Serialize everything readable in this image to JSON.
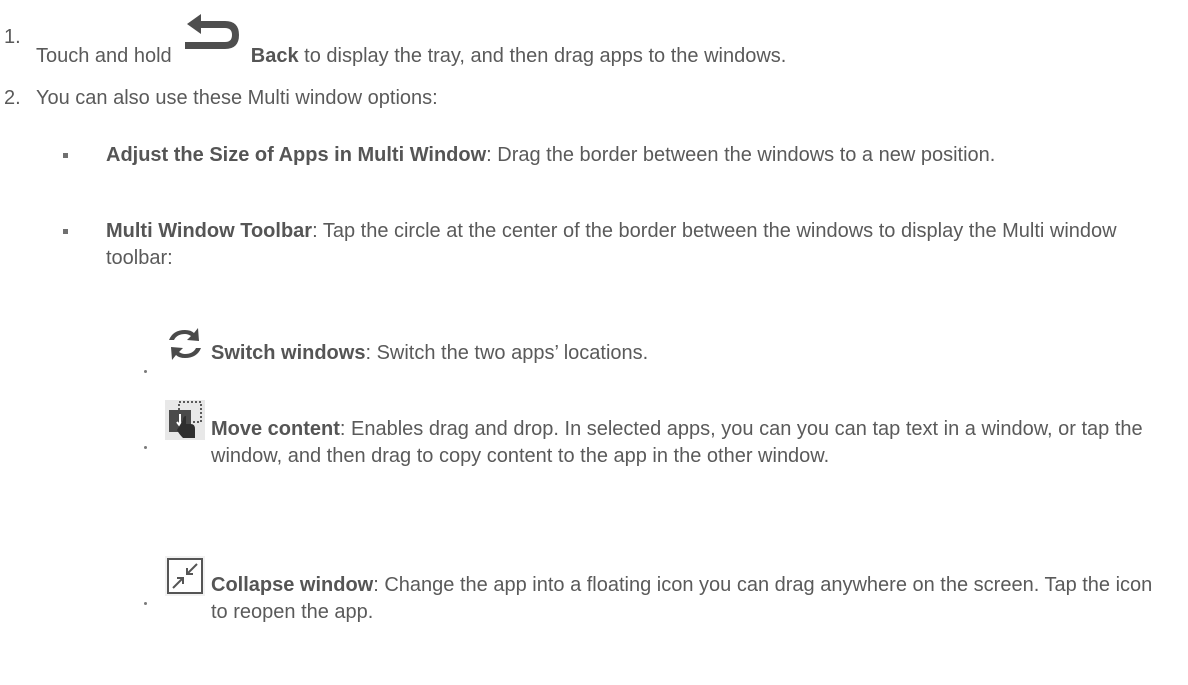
{
  "colors": {
    "text": "#5a5a5a",
    "icon": "#505050",
    "icon_bg": "#e6e6e6"
  },
  "step1": {
    "number": "1.",
    "text_before": "Touch and hold",
    "icon": "back-arrow-icon",
    "bold": "Back",
    "text_after": "to display the tray, and then drag apps to the windows."
  },
  "step2": {
    "number": "2.",
    "text": "You can also use these Multi window options:"
  },
  "options": [
    {
      "title": "Adjust the Size of Apps in Multi Window",
      "desc": ": Drag the border between the windows to a new position."
    },
    {
      "title": "Multi Window Toolbar",
      "desc": ": Tap the circle at the center of the border between the windows to display the Multi window toolbar:"
    }
  ],
  "toolbar_items": [
    {
      "icon": "switch-windows-icon",
      "title": "Switch windows",
      "desc": ": Switch the two apps’ locations."
    },
    {
      "icon": "move-content-icon",
      "title": "Move content",
      "desc": ": Enables drag and drop. In selected apps, you can you can tap text in a window, or tap the window, and then drag to copy content to the app in the other window."
    },
    {
      "icon": "collapse-window-icon",
      "title": "Collapse window",
      "desc": ": Change the app into a floating icon you can drag anywhere on the screen. Tap the icon to reopen the app."
    }
  ]
}
